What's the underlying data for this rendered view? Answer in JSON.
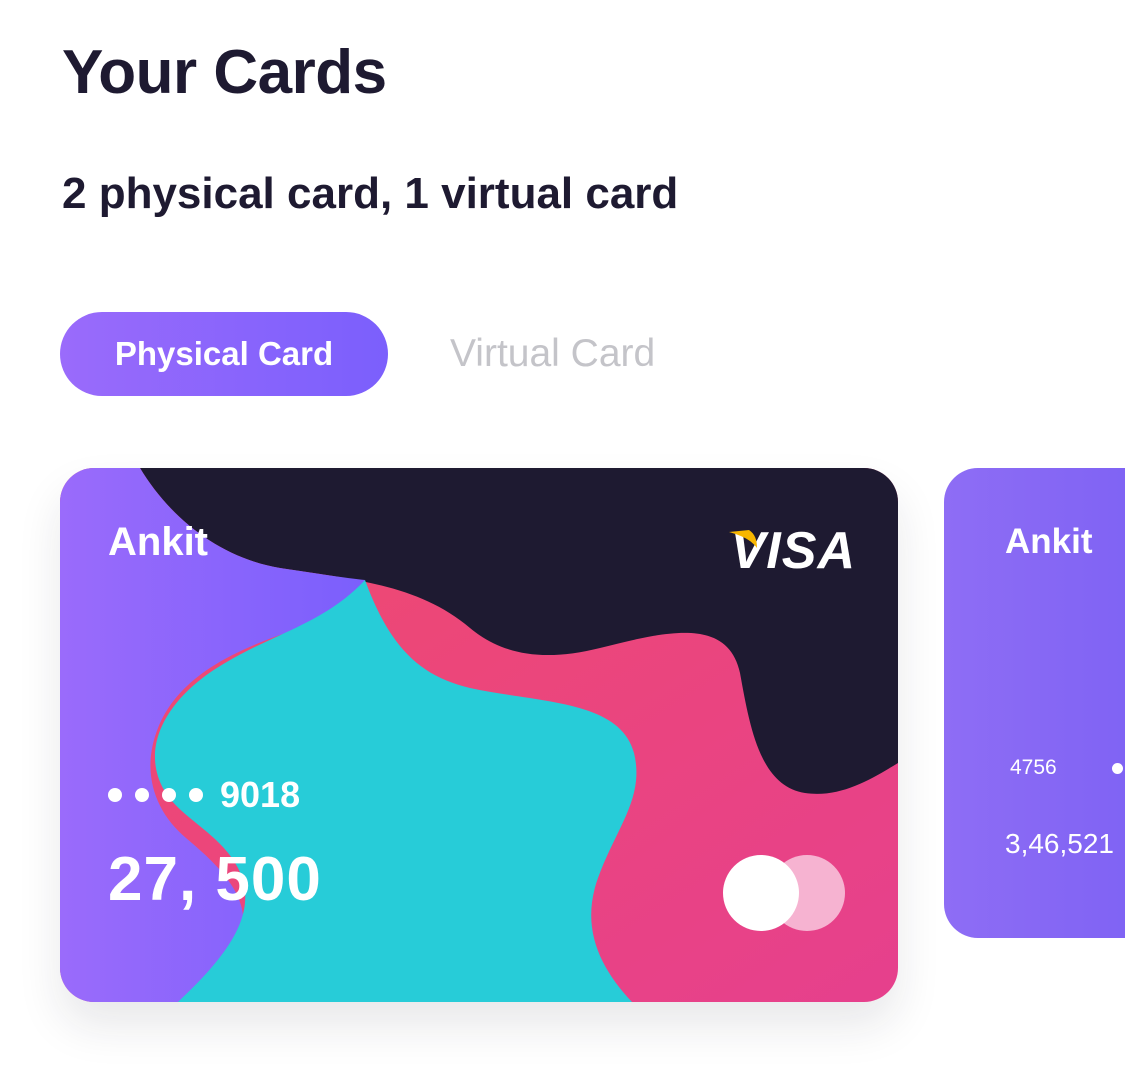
{
  "header": {
    "title": "Your Cards",
    "subtitle": "2 physical card, 1 virtual card"
  },
  "tabs": {
    "active_label": "Physical Card",
    "inactive_label": "Virtual Card"
  },
  "cards": [
    {
      "holder": "Ankit",
      "network": "VISA",
      "masked_dots": "••••",
      "last4": "9018",
      "balance": "27, 500",
      "secondary_logo": "mastercard-icon"
    },
    {
      "holder": "Ankit",
      "number_start": "4756",
      "balance": "3,46,521"
    }
  ],
  "colors": {
    "text_dark": "#1e1a31",
    "accent_purple": "#7b5ffc",
    "accent_purple_light": "#9a6bfb",
    "card_dark": "#1e1a31",
    "card_pink": "#ee4b7d",
    "card_cyan": "#27ccd8",
    "visa_flag_yellow": "#f7b600",
    "tab_inactive_text": "#c4c4c9"
  }
}
